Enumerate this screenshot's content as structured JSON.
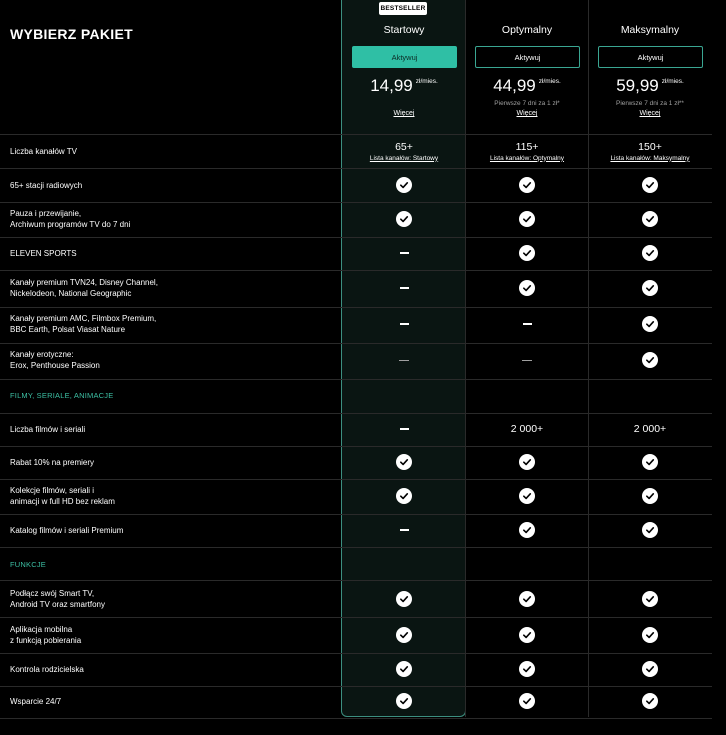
{
  "title": "WYBIERZ PAKIET",
  "badge": "BESTSELLER",
  "plans": [
    {
      "name": "Startowy",
      "button": "Aktywuj",
      "price": "14,99",
      "unit": "zł/mies.",
      "promo": "",
      "more": "Więcej"
    },
    {
      "name": "Optymalny",
      "button": "Aktywuj",
      "price": "44,99",
      "unit": "zł/mies.",
      "promo": "Pierwsze 7 dni za 1 zł*",
      "more": "Więcej"
    },
    {
      "name": "Maksymalny",
      "button": "Aktywuj",
      "price": "59,99",
      "unit": "zł/mies.",
      "promo": "Pierwsze 7 dni za 1 zł**",
      "more": "Więcej"
    }
  ],
  "channels": {
    "label": "Liczba kanałów TV",
    "values": [
      "65+",
      "115+",
      "150+"
    ],
    "links": [
      "Lista kanałów: Startowy",
      "Lista kanałów: Optymalny",
      "Lista kanałów: Maksymalny"
    ]
  },
  "rows": [
    {
      "l1": "65+ stacji radiowych",
      "l2": ""
    },
    {
      "l1": "Pauza i przewijanie,",
      "l2": "Archiwum programów TV do 7 dni"
    },
    {
      "l1": "ELEVEN SPORTS",
      "l2": ""
    },
    {
      "l1": "Kanały premium TVN24, Disney Channel,",
      "l2": "Nickelodeon, National Geographic"
    },
    {
      "l1": "Kanały premium AMC, Filmbox Premium,",
      "l2": "BBC Earth, Polsat Viasat Nature"
    },
    {
      "l1": "Kanały erotyczne:",
      "l2": "Erox, Penthouse Passion"
    }
  ],
  "section1": "FILMY, SERIALE, ANIMACJE",
  "films": {
    "label": "Liczba filmów i seriali",
    "values": [
      "2 000+",
      "2 000+"
    ]
  },
  "rows2": [
    {
      "l1": "Rabat 10% na premiery",
      "l2": ""
    },
    {
      "l1": "Kolekcje filmów, seriali i",
      "l2": "animacji w full HD bez reklam"
    },
    {
      "l1": "Katalog filmów i seriali Premium",
      "l2": ""
    }
  ],
  "section2": "FUNKCJE",
  "rows3": [
    {
      "l1": "Podłącz swój Smart TV,",
      "l2": "Android TV oraz smartfony"
    },
    {
      "l1": "Aplikacja mobilna",
      "l2": "z funkcją pobierania"
    },
    {
      "l1": "Kontrola rodzicielska",
      "l2": ""
    },
    {
      "l1": "Wsparcie 24/7",
      "l2": ""
    }
  ]
}
